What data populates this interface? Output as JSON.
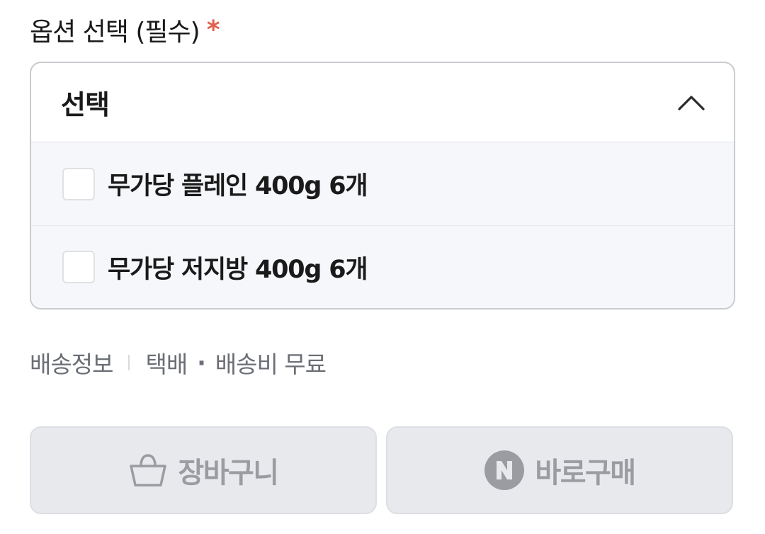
{
  "option_section": {
    "title": "옵션 선택 (필수)",
    "required_mark": "*"
  },
  "dropdown": {
    "selected_label": "선택",
    "toggle_icon": "chevron-up-icon",
    "options": [
      {
        "label": "무가당 플레인 400g 6개",
        "checked": false
      },
      {
        "label": "무가당 저지방 400g 6개",
        "checked": false
      }
    ]
  },
  "shipping": {
    "label": "배송정보",
    "method": "택배",
    "separator": "·",
    "fee": "배송비 무료"
  },
  "actions": {
    "cart_label": "장바구니",
    "cart_icon": "shopping-basket-icon",
    "buy_label": "바로구매",
    "buy_icon": "naver-n-icon"
  },
  "colors": {
    "required": "#e0604f",
    "button_bg": "#e8e9ed",
    "button_text": "#9a9ca1",
    "option_bg": "#f6f7fb"
  }
}
